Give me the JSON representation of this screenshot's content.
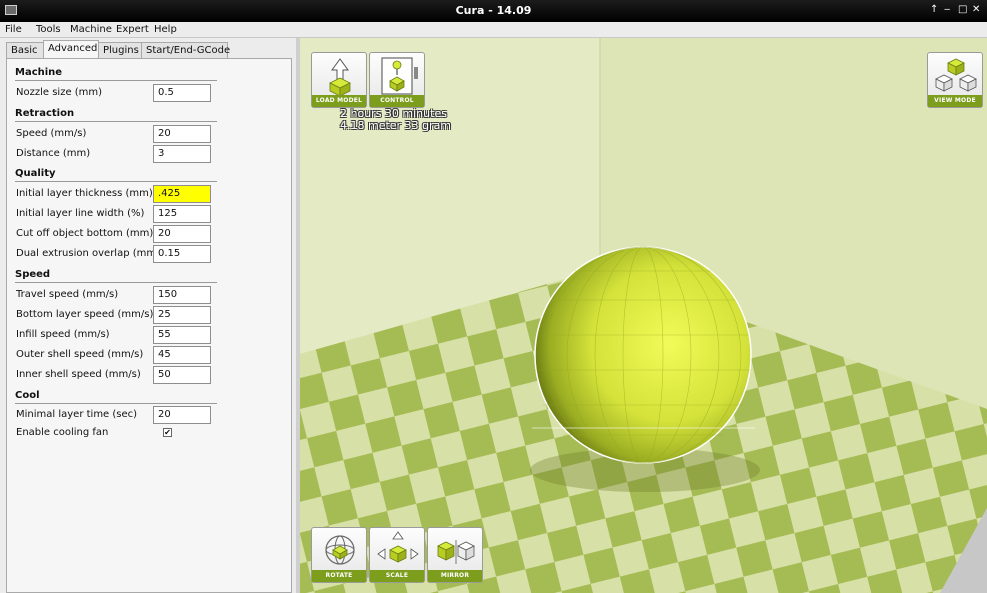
{
  "window": {
    "title": "Cura - 14.09",
    "controls": [
      "↑",
      "‒",
      "□",
      "✕"
    ]
  },
  "menu": [
    "File",
    "Tools",
    "Machine",
    "Expert",
    "Help"
  ],
  "tabs": [
    "Basic",
    "Advanced",
    "Plugins",
    "Start/End-GCode"
  ],
  "active_tab": "Advanced",
  "sections": {
    "machine": {
      "title": "Machine",
      "fields": [
        {
          "label": "Nozzle size (mm)",
          "value": "0.5"
        }
      ]
    },
    "retraction": {
      "title": "Retraction",
      "fields": [
        {
          "label": "Speed (mm/s)",
          "value": "20"
        },
        {
          "label": "Distance (mm)",
          "value": "3"
        }
      ]
    },
    "quality": {
      "title": "Quality",
      "fields": [
        {
          "label": "Initial layer thickness (mm)",
          "value": ".425"
        },
        {
          "label": "Initial layer line width (%)",
          "value": "125"
        },
        {
          "label": "Cut off object bottom (mm)",
          "value": "20"
        },
        {
          "label": "Dual extrusion overlap (mm)",
          "value": "0.15"
        }
      ]
    },
    "speed": {
      "title": "Speed",
      "fields": [
        {
          "label": "Travel speed (mm/s)",
          "value": "150"
        },
        {
          "label": "Bottom layer speed (mm/s)",
          "value": "25"
        },
        {
          "label": "Infill speed (mm/s)",
          "value": "55"
        },
        {
          "label": "Outer shell speed (mm/s)",
          "value": "45"
        },
        {
          "label": "Inner shell speed (mm/s)",
          "value": "50"
        }
      ]
    },
    "cool": {
      "title": "Cool",
      "fields": [
        {
          "label": "Minimal layer time (sec)",
          "value": "20"
        }
      ],
      "checkbox": {
        "label": "Enable cooling fan",
        "checked": true,
        "mark": "✔"
      }
    }
  },
  "viewport": {
    "buttons": {
      "load": "LOAD MODEL",
      "control": "CONTROL",
      "view": "VIEW MODE",
      "rotate": "ROTATE",
      "scale": "SCALE",
      "mirror": "MIRROR"
    },
    "print_time": "2 hours 30 minutes",
    "print_amount": "4.18 meter 33 gram"
  },
  "colors": {
    "accent": "#7c9e1c",
    "model": "#dbe83a",
    "highlight_field": "#ffff00",
    "bed_light": "#dfe6b4",
    "bed_dark": "#a2b950"
  }
}
